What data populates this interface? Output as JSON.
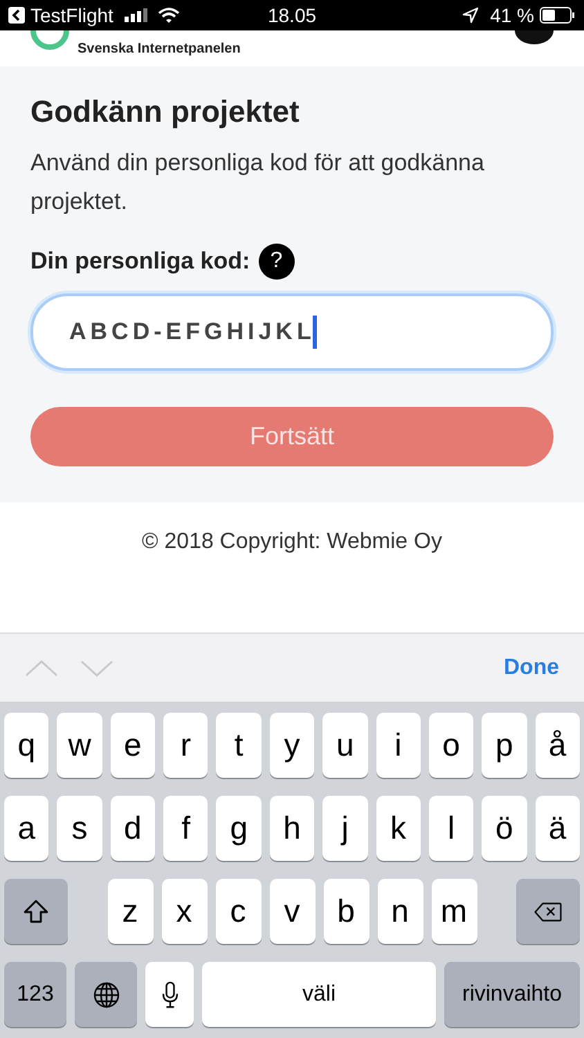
{
  "status_bar": {
    "back_app": "TestFlight",
    "time": "18.05",
    "battery": "41 %"
  },
  "header": {
    "brand": "Svenska Internetpanelen"
  },
  "card": {
    "title": "Godkänn projektet",
    "description": "Använd din personliga kod för att godkänna projektet.",
    "label": "Din personliga kod:",
    "help": "?",
    "code": "ABCD-EFGHIJKL",
    "button": "Fortsätt"
  },
  "footer": "© 2018 Copyright: Webmie Oy",
  "accessory_bar": {
    "done": "Done"
  },
  "keyboard": {
    "rows": [
      [
        "q",
        "w",
        "e",
        "r",
        "t",
        "y",
        "u",
        "i",
        "o",
        "p",
        "å"
      ],
      [
        "a",
        "s",
        "d",
        "f",
        "g",
        "h",
        "j",
        "k",
        "l",
        "ö",
        "ä"
      ]
    ],
    "shift_row_letters": [
      "z",
      "x",
      "c",
      "v",
      "b",
      "n",
      "m"
    ],
    "number_key": "123",
    "space_key": "väli",
    "return_key": "rivinvaihto"
  }
}
